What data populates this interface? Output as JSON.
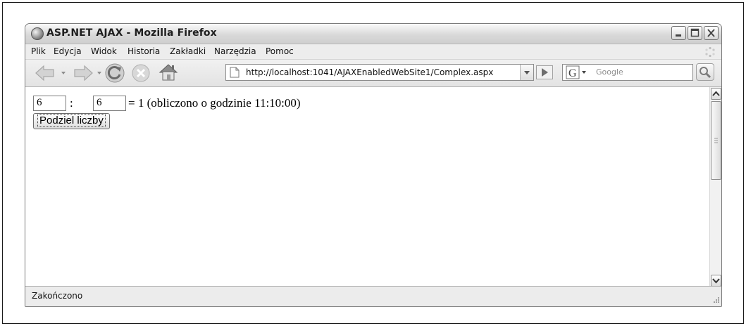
{
  "window": {
    "title": "ASP.NET AJAX - Mozilla Firefox"
  },
  "menu": {
    "items": [
      "Plik",
      "Edycja",
      "Widok",
      "Historia",
      "Zakładki",
      "Narzędzia",
      "Pomoc"
    ]
  },
  "toolbar": {
    "back_icon": "back-arrow-icon",
    "forward_icon": "forward-arrow-icon",
    "reload_icon": "reload-icon",
    "stop_icon": "stop-icon",
    "home_icon": "home-icon",
    "url": "http://localhost:1041/AJAXEnabledWebSite1/Complex.aspx",
    "search_placeholder": "Google",
    "search_engine": "G"
  },
  "page": {
    "input_a_value": "6",
    "separator": ":",
    "input_b_value": "6",
    "result_text": "= 1 (obliczono o godzinie 11:10:00)",
    "button_label": "Podziel liczby"
  },
  "status": {
    "text": "Zakończono"
  },
  "colors": {
    "chrome": "#ececec",
    "content_bg": "#ffffff",
    "border": "#7a7a7a"
  }
}
